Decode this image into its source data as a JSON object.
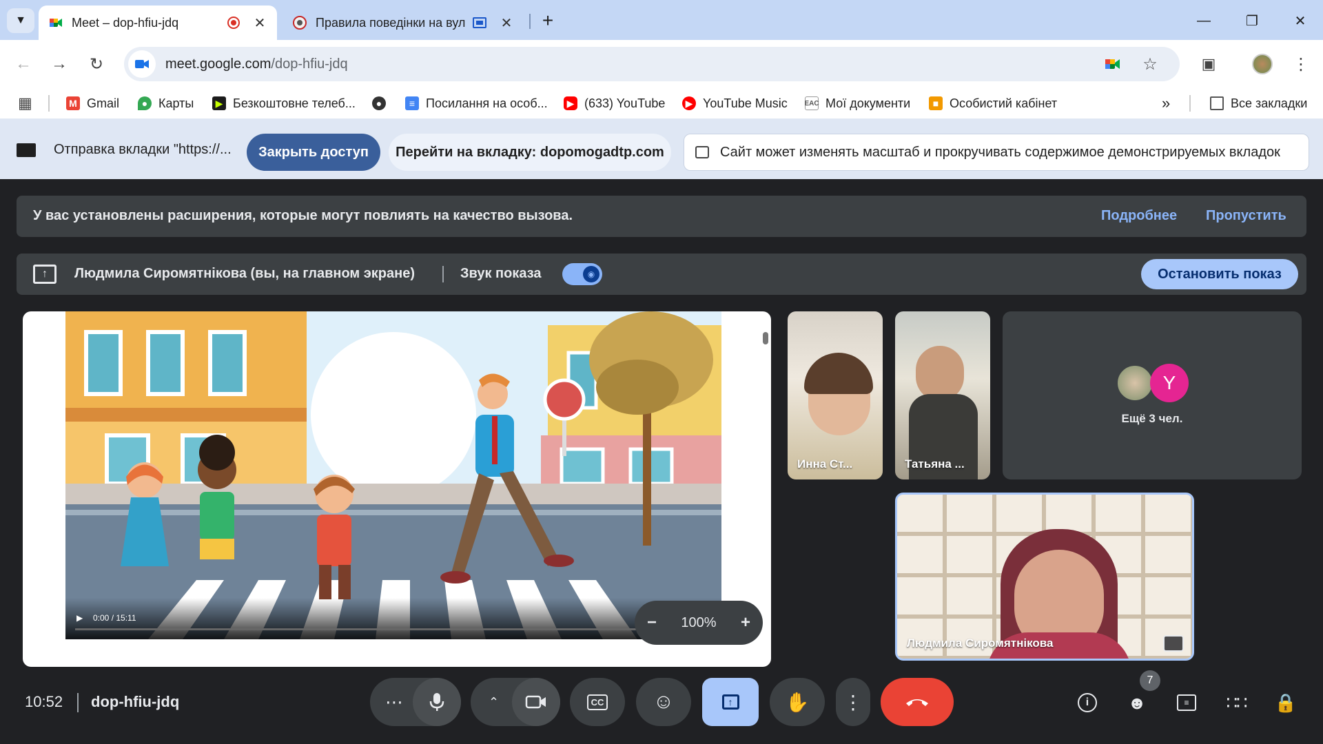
{
  "browser": {
    "tabs": [
      {
        "title": "Meet – dop-hfiu-jdq",
        "active": true
      },
      {
        "title": "Правила поведінки на вул",
        "active": false
      }
    ],
    "new_tab_symbol": "+",
    "url_domain": "meet.google.com",
    "url_path": "/dop-hfiu-jdq"
  },
  "bookmarks": [
    {
      "label": "Gmail",
      "icon": "gmail-icon",
      "color": "#ea4335"
    },
    {
      "label": "Карты",
      "icon": "maps-icon",
      "color": "#34a853"
    },
    {
      "label": "Безкоштовне телеб...",
      "icon": "tv-icon",
      "color": "#1b1b1b"
    },
    {
      "label": "",
      "icon": "globe-icon",
      "color": "#333333"
    },
    {
      "label": "Посилання на особ...",
      "icon": "docs-icon",
      "color": "#4285f4"
    },
    {
      "label": "(633) YouTube",
      "icon": "youtube-icon",
      "color": "#ff0000"
    },
    {
      "label": "YouTube Music",
      "icon": "youtube-music-icon",
      "color": "#ff0000"
    },
    {
      "label": "Мої документи",
      "icon": "documents-icon",
      "color": "#555555"
    },
    {
      "label": "Особистий кабінет",
      "icon": "cabinet-icon",
      "color": "#f29900"
    }
  ],
  "bookmarks_all": "Все закладки",
  "sharebar": {
    "text": "Отправка вкладки \"https://...",
    "stop": "Закрыть доступ",
    "goto": "Перейти на вкладку: dopomogadtp.com",
    "notice": "Сайт может изменять масштаб и прокручивать содержимое демонстрируемых вкладок"
  },
  "meet": {
    "ext_banner": {
      "text": "У вас установлены расширения, которые могут повлиять на качество вызова.",
      "more": "Подробнее",
      "skip": "Пропустить"
    },
    "presenting": {
      "name": "Людмила Сиромятнікова (вы, на главном экране)",
      "audio": "Звук показа",
      "stop": "Остановить показ"
    },
    "video": {
      "time": "0:00 / 15:11",
      "progress": 0
    },
    "zoom": "100%",
    "participants": [
      {
        "name": "Инна Ст..."
      },
      {
        "name": "Татьяна ..."
      }
    ],
    "more": {
      "initial": "Y",
      "label": "Ещё 3 чел."
    },
    "self": {
      "name": "Людмила Сиромятнікова"
    },
    "clock": "10:52",
    "code": "dop-hfiu-jdq",
    "people_count": "7"
  },
  "colors": {
    "accent": "#a8c7fa",
    "end_call": "#ea4335",
    "link": "#8ab4f8"
  }
}
